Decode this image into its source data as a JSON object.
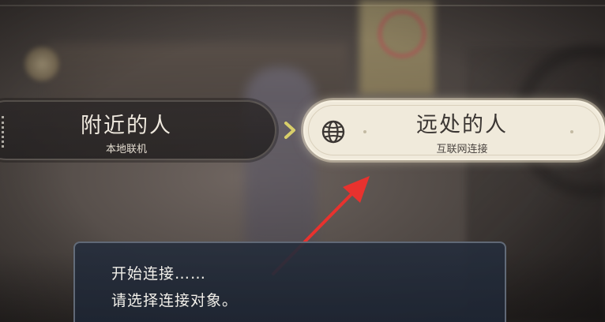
{
  "options": {
    "nearby": {
      "title": "附近的人",
      "subtitle": "本地联机",
      "selected": false
    },
    "far": {
      "title": "远处的人",
      "subtitle": "互联网连接",
      "selected": true,
      "icon": "globe-icon"
    },
    "separator_icon": "chevron-right-icon"
  },
  "dialog": {
    "line1": "开始连接……",
    "line2": "请选择连接对象。"
  },
  "annotation": {
    "icon": "red-arrow-icon",
    "color": "#e8322e"
  },
  "colors": {
    "selected_fill": "#f0eadb",
    "unselected_fill": "#2a2626",
    "chevron": "#d8cf6a",
    "dialog_fill": "#262e3c"
  }
}
